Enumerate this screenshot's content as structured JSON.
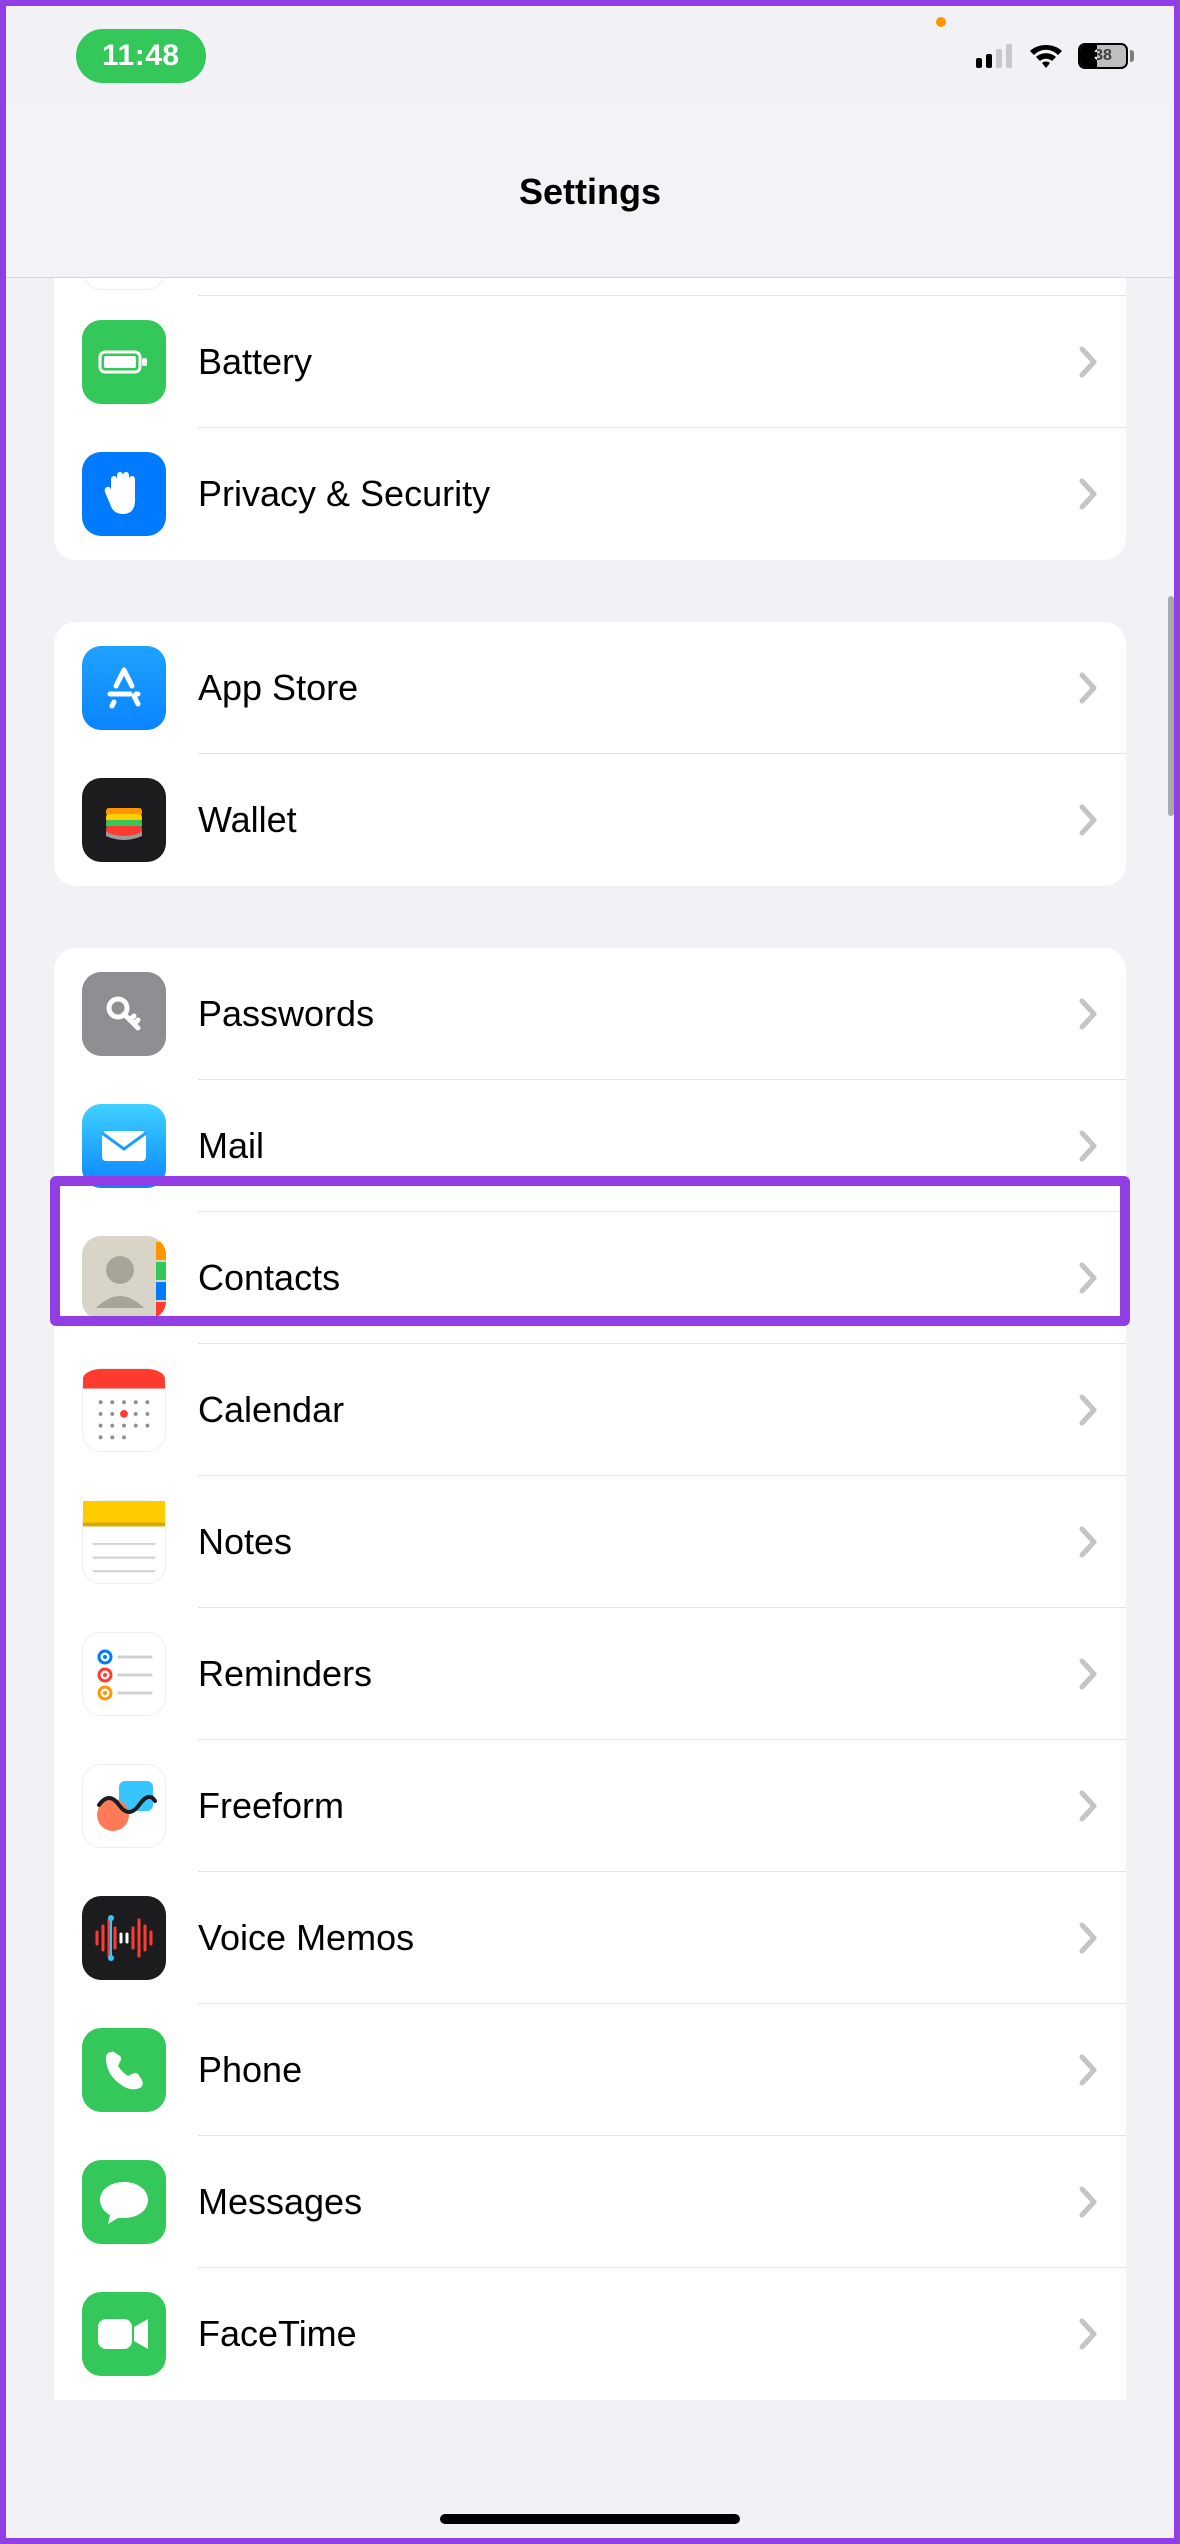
{
  "status": {
    "time": "11:48",
    "battery_percent": "38"
  },
  "header": {
    "title": "Settings"
  },
  "groups": [
    {
      "id": "system2",
      "partial_top": true,
      "rows": [
        {
          "key": "battery",
          "label": "Battery",
          "icon": "battery-icon",
          "icon_bg": "bg-green"
        },
        {
          "key": "privacy",
          "label": "Privacy & Security",
          "icon": "hand-icon",
          "icon_bg": "bg-blue"
        }
      ]
    },
    {
      "id": "store",
      "rows": [
        {
          "key": "appstore",
          "label": "App Store",
          "icon": "appstore-icon",
          "icon_bg": "bg-appstore"
        },
        {
          "key": "wallet",
          "label": "Wallet",
          "icon": "wallet-icon",
          "icon_bg": "bg-wallet"
        }
      ]
    },
    {
      "id": "apps",
      "rows": [
        {
          "key": "passwords",
          "label": "Passwords",
          "icon": "key-icon",
          "icon_bg": "bg-grey"
        },
        {
          "key": "mail",
          "label": "Mail",
          "icon": "envelope-icon",
          "icon_bg": "bg-mail",
          "highlighted": true
        },
        {
          "key": "contacts",
          "label": "Contacts",
          "icon": "contacts-icon",
          "icon_bg": "bg-contacts"
        },
        {
          "key": "calendar",
          "label": "Calendar",
          "icon": "calendar-icon",
          "icon_bg": "bg-calendar"
        },
        {
          "key": "notes",
          "label": "Notes",
          "icon": "notes-icon",
          "icon_bg": "bg-notes"
        },
        {
          "key": "reminders",
          "label": "Reminders",
          "icon": "reminders-icon",
          "icon_bg": "bg-reminders"
        },
        {
          "key": "freeform",
          "label": "Freeform",
          "icon": "freeform-icon",
          "icon_bg": "bg-freeform"
        },
        {
          "key": "voicememos",
          "label": "Voice Memos",
          "icon": "voicememos-icon",
          "icon_bg": "bg-voicememos"
        },
        {
          "key": "phone",
          "label": "Phone",
          "icon": "phone-icon",
          "icon_bg": "bg-phone"
        },
        {
          "key": "messages",
          "label": "Messages",
          "icon": "messages-icon",
          "icon_bg": "bg-messages"
        },
        {
          "key": "facetime",
          "label": "FaceTime",
          "icon": "facetime-icon",
          "icon_bg": "bg-facetime"
        }
      ]
    }
  ]
}
